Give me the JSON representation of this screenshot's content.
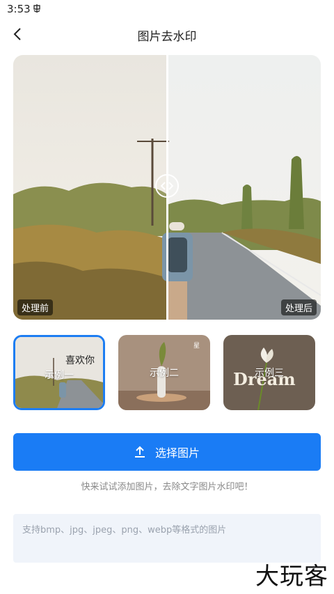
{
  "status_bar": {
    "time": "3:53"
  },
  "header": {
    "title": "图片去水印"
  },
  "compare": {
    "before_label": "处理前",
    "after_label": "处理后"
  },
  "samples": [
    {
      "label": "示例一",
      "overlay": "喜欢你"
    },
    {
      "label": "示例二"
    },
    {
      "label": "示例三",
      "overlay": "Dream"
    }
  ],
  "actions": {
    "select_label": "选择图片"
  },
  "hint": "快来试试添加图片，去除文字图片水印吧！",
  "format_box": {
    "text": "支持bmp、jpg、jpeg、png、webp等格式的图片"
  },
  "watermark": "大玩客",
  "colors": {
    "accent": "#1a7cf5",
    "selected_border": "#1d7df2",
    "format_bg": "#f0f4fa"
  }
}
